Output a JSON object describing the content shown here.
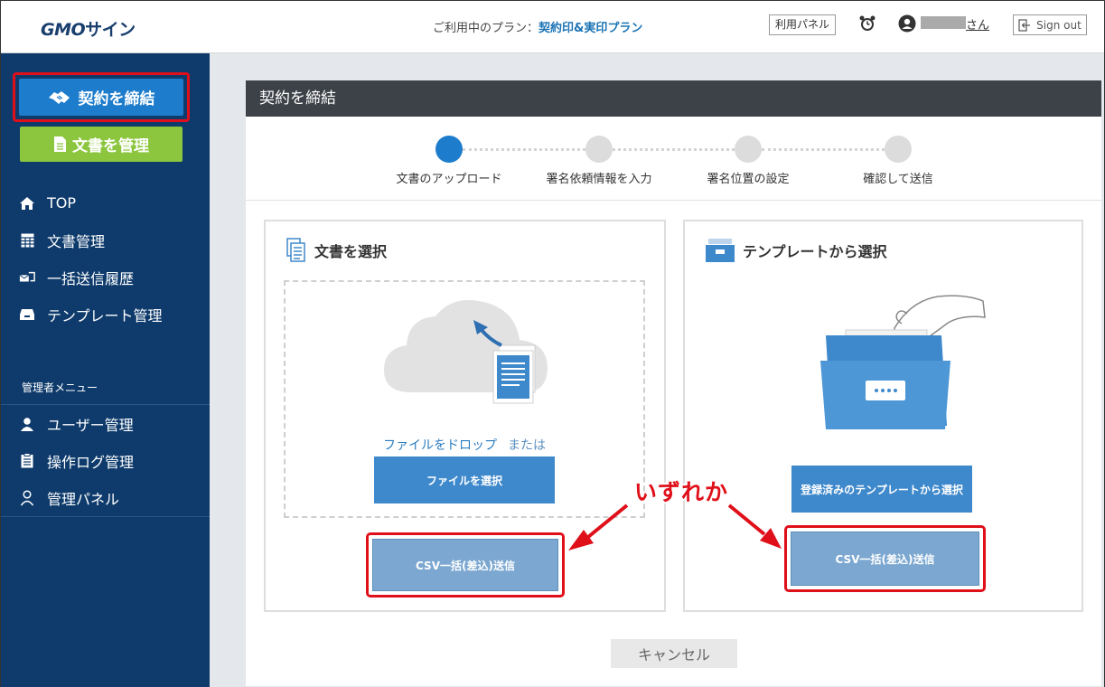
{
  "header": {
    "logo_gmo": "GMO",
    "logo_sign": "サイン",
    "plan_label": "ご利用中のプラン：",
    "plan_name": "契約印&実印プラン",
    "panel_button": "利用パネル",
    "user_suffix": "さん",
    "signout": "Sign out",
    "icons": [
      "alarm-clock-icon",
      "user-icon",
      "sign-out-icon"
    ]
  },
  "sidebar": {
    "contract_button": "契約を締結",
    "docs_button": "文書を管理",
    "items": [
      {
        "label": "TOP",
        "icon": "home-icon"
      },
      {
        "label": "文書管理",
        "icon": "grid-icon"
      },
      {
        "label": "一括送信履歴",
        "icon": "batch-send-icon"
      },
      {
        "label": "テンプレート管理",
        "icon": "tray-icon"
      }
    ],
    "admin_title": "管理者メニュー",
    "admin_items": [
      {
        "label": "ユーザー管理",
        "icon": "user-icon"
      },
      {
        "label": "操作ログ管理",
        "icon": "clipboard-icon"
      },
      {
        "label": "管理パネル",
        "icon": "admin-user-icon"
      }
    ]
  },
  "main": {
    "title": "契約を締結",
    "steps": [
      {
        "label": "文書のアップロード",
        "active": true
      },
      {
        "label": "署名依頼情報を入力",
        "active": false
      },
      {
        "label": "署名位置の設定",
        "active": false
      },
      {
        "label": "確認して送信",
        "active": false
      }
    ],
    "left_panel": {
      "title": "文書を選択",
      "drop_text": "ファイルをドロップ",
      "drop_or": "または",
      "select_button": "ファイルを選択",
      "csv_button": "CSV一括(差込)送信"
    },
    "right_panel": {
      "title": "テンプレートから選択",
      "template_button": "登録済みのテンプレートから選択",
      "csv_button": "CSV一括(差込)送信"
    },
    "cancel_button": "キャンセル"
  },
  "annotation": "いずれか",
  "colors": {
    "sidebar_bg": "#0e3b6c",
    "primary_blue": "#1d7ccc",
    "green": "#8cc63f",
    "highlight_red": "#e0101a",
    "header_dark": "#3d4248"
  }
}
